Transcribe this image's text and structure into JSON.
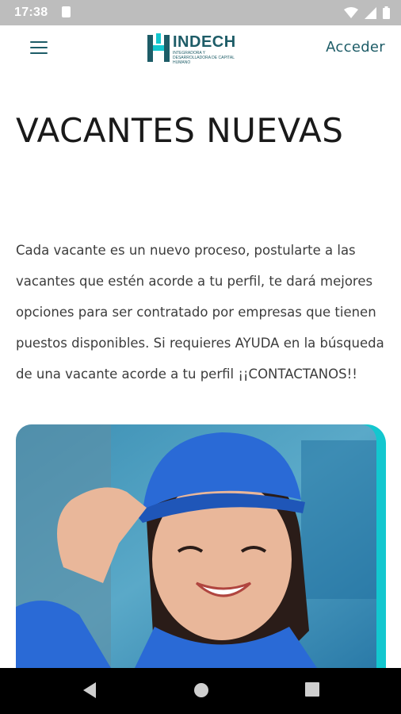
{
  "status_bar": {
    "time": "17:38"
  },
  "header": {
    "logo_text": "INDECH",
    "logo_tagline": "Integradora y desarrolladora de capital humano",
    "login_label": "Acceder"
  },
  "main": {
    "title": "VACANTES NUEVAS",
    "description": "Cada vacante es un nuevo proceso, postularte a las vacantes que estén acorde a tu perfil, te dará mejores opciones para ser contratado por empresas que tienen puestos disponibles. Si requieres AYUDA en la búsqueda de una vacante acorde a tu perfil ¡¡CONTACTANOS!!"
  },
  "colors": {
    "brand": "#1d5c67",
    "accent": "#13c7cf",
    "cap_blue": "#2a6ad6"
  },
  "icons": [
    "menu-icon",
    "sim-card-icon",
    "wifi-icon",
    "signal-icon",
    "battery-icon",
    "nav-back-icon",
    "nav-home-icon",
    "nav-recents-icon"
  ]
}
